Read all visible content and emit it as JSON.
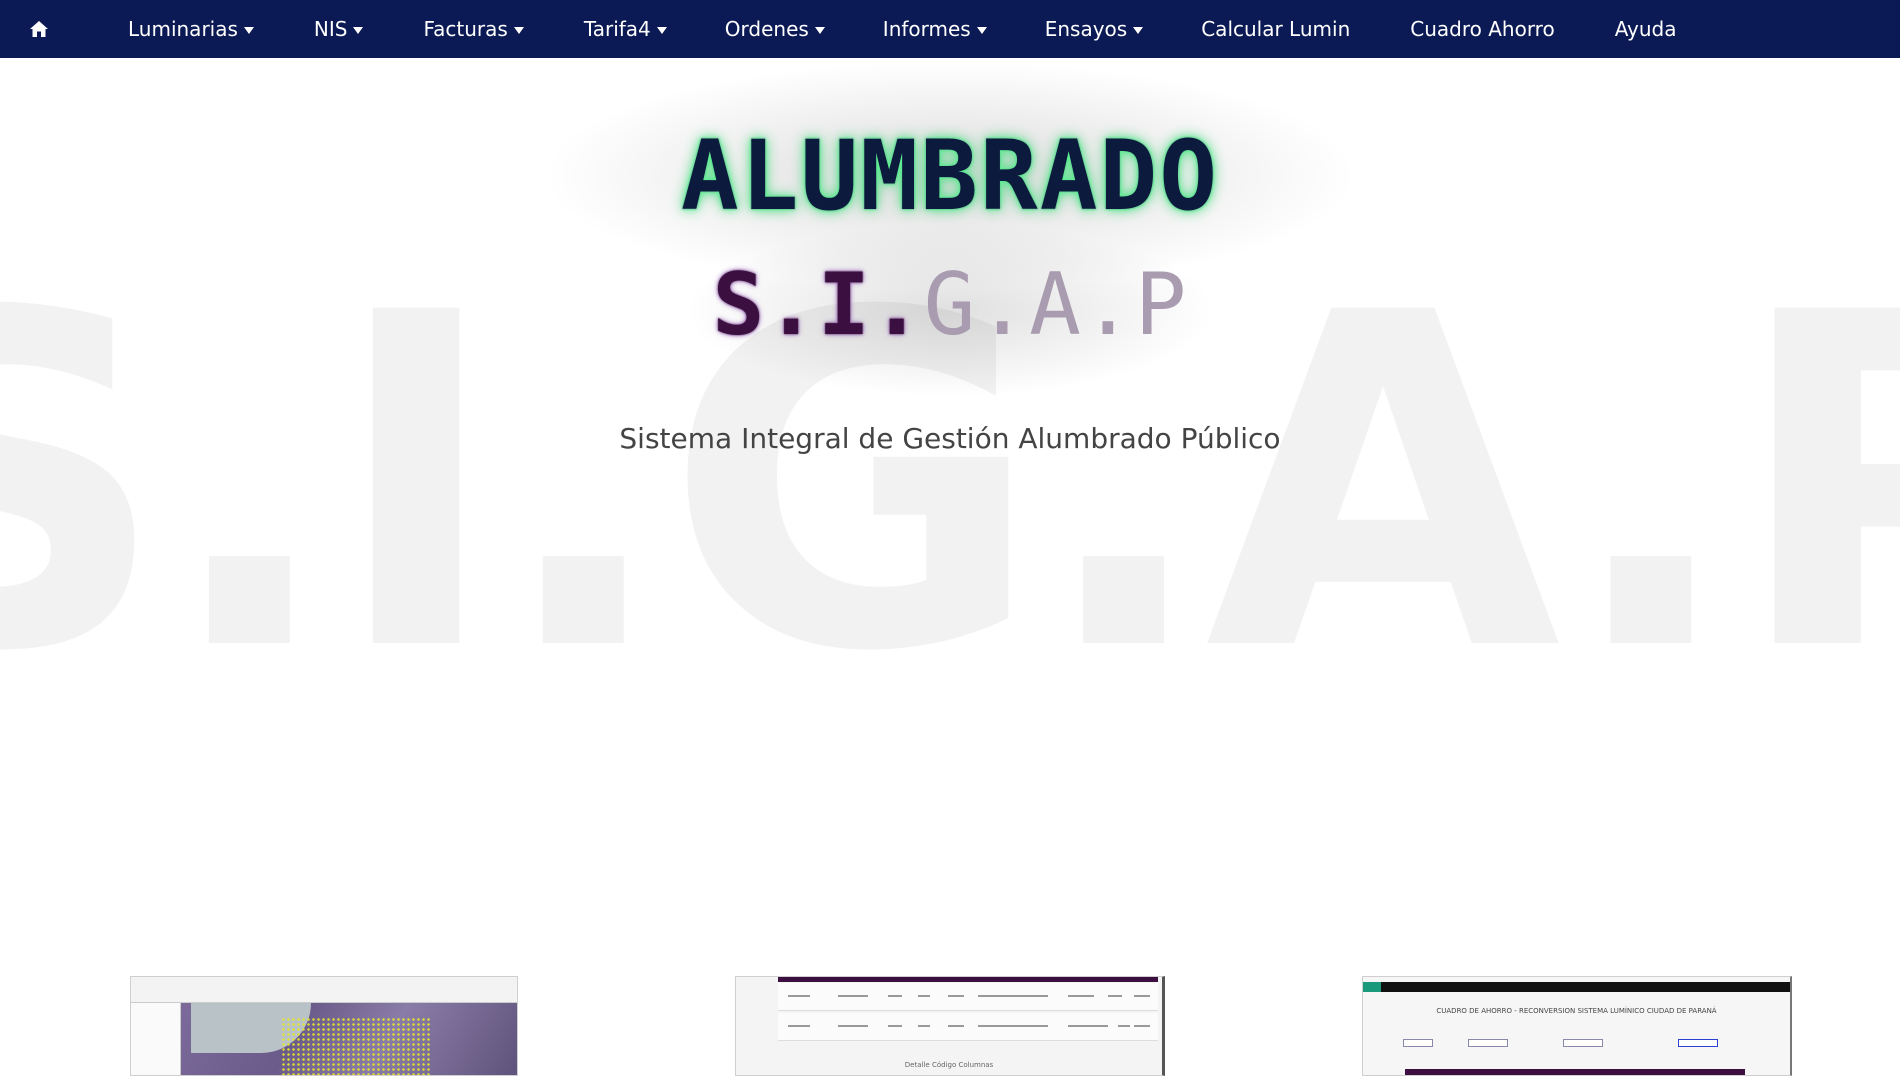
{
  "navbar": {
    "home_icon": "home-icon",
    "items": [
      {
        "label": "Luminarias",
        "dropdown": true
      },
      {
        "label": "NIS",
        "dropdown": true
      },
      {
        "label": "Facturas",
        "dropdown": true
      },
      {
        "label": "Tarifa4",
        "dropdown": true
      },
      {
        "label": "Ordenes",
        "dropdown": true
      },
      {
        "label": "Informes",
        "dropdown": true
      },
      {
        "label": "Ensayos",
        "dropdown": true
      },
      {
        "label": "Calcular Lumin",
        "dropdown": false
      },
      {
        "label": "Cuadro Ahorro",
        "dropdown": false
      },
      {
        "label": "Ayuda",
        "dropdown": false
      }
    ],
    "background": "#0b1a55"
  },
  "hero": {
    "title": "ALUMBRADO",
    "sub_a": "S.I.",
    "sub_b": "G.A.P",
    "watermark": "S.I.G.A.P",
    "subtitle": "Sistema Integral de Gestión Alumbrado Público",
    "title_color": "#0c1a3d",
    "title_glow": "#66ff99",
    "sub_color": "#3b0f3f",
    "sub_light_color": "#a99bb0"
  },
  "thumbnails": {
    "t2_caption": "Detalle Código Columnas",
    "t3_title": "CUADRO DE AHORRO - RECONVERSION SISTEMA LUMÍNICO CIUDAD DE PARANÁ"
  }
}
